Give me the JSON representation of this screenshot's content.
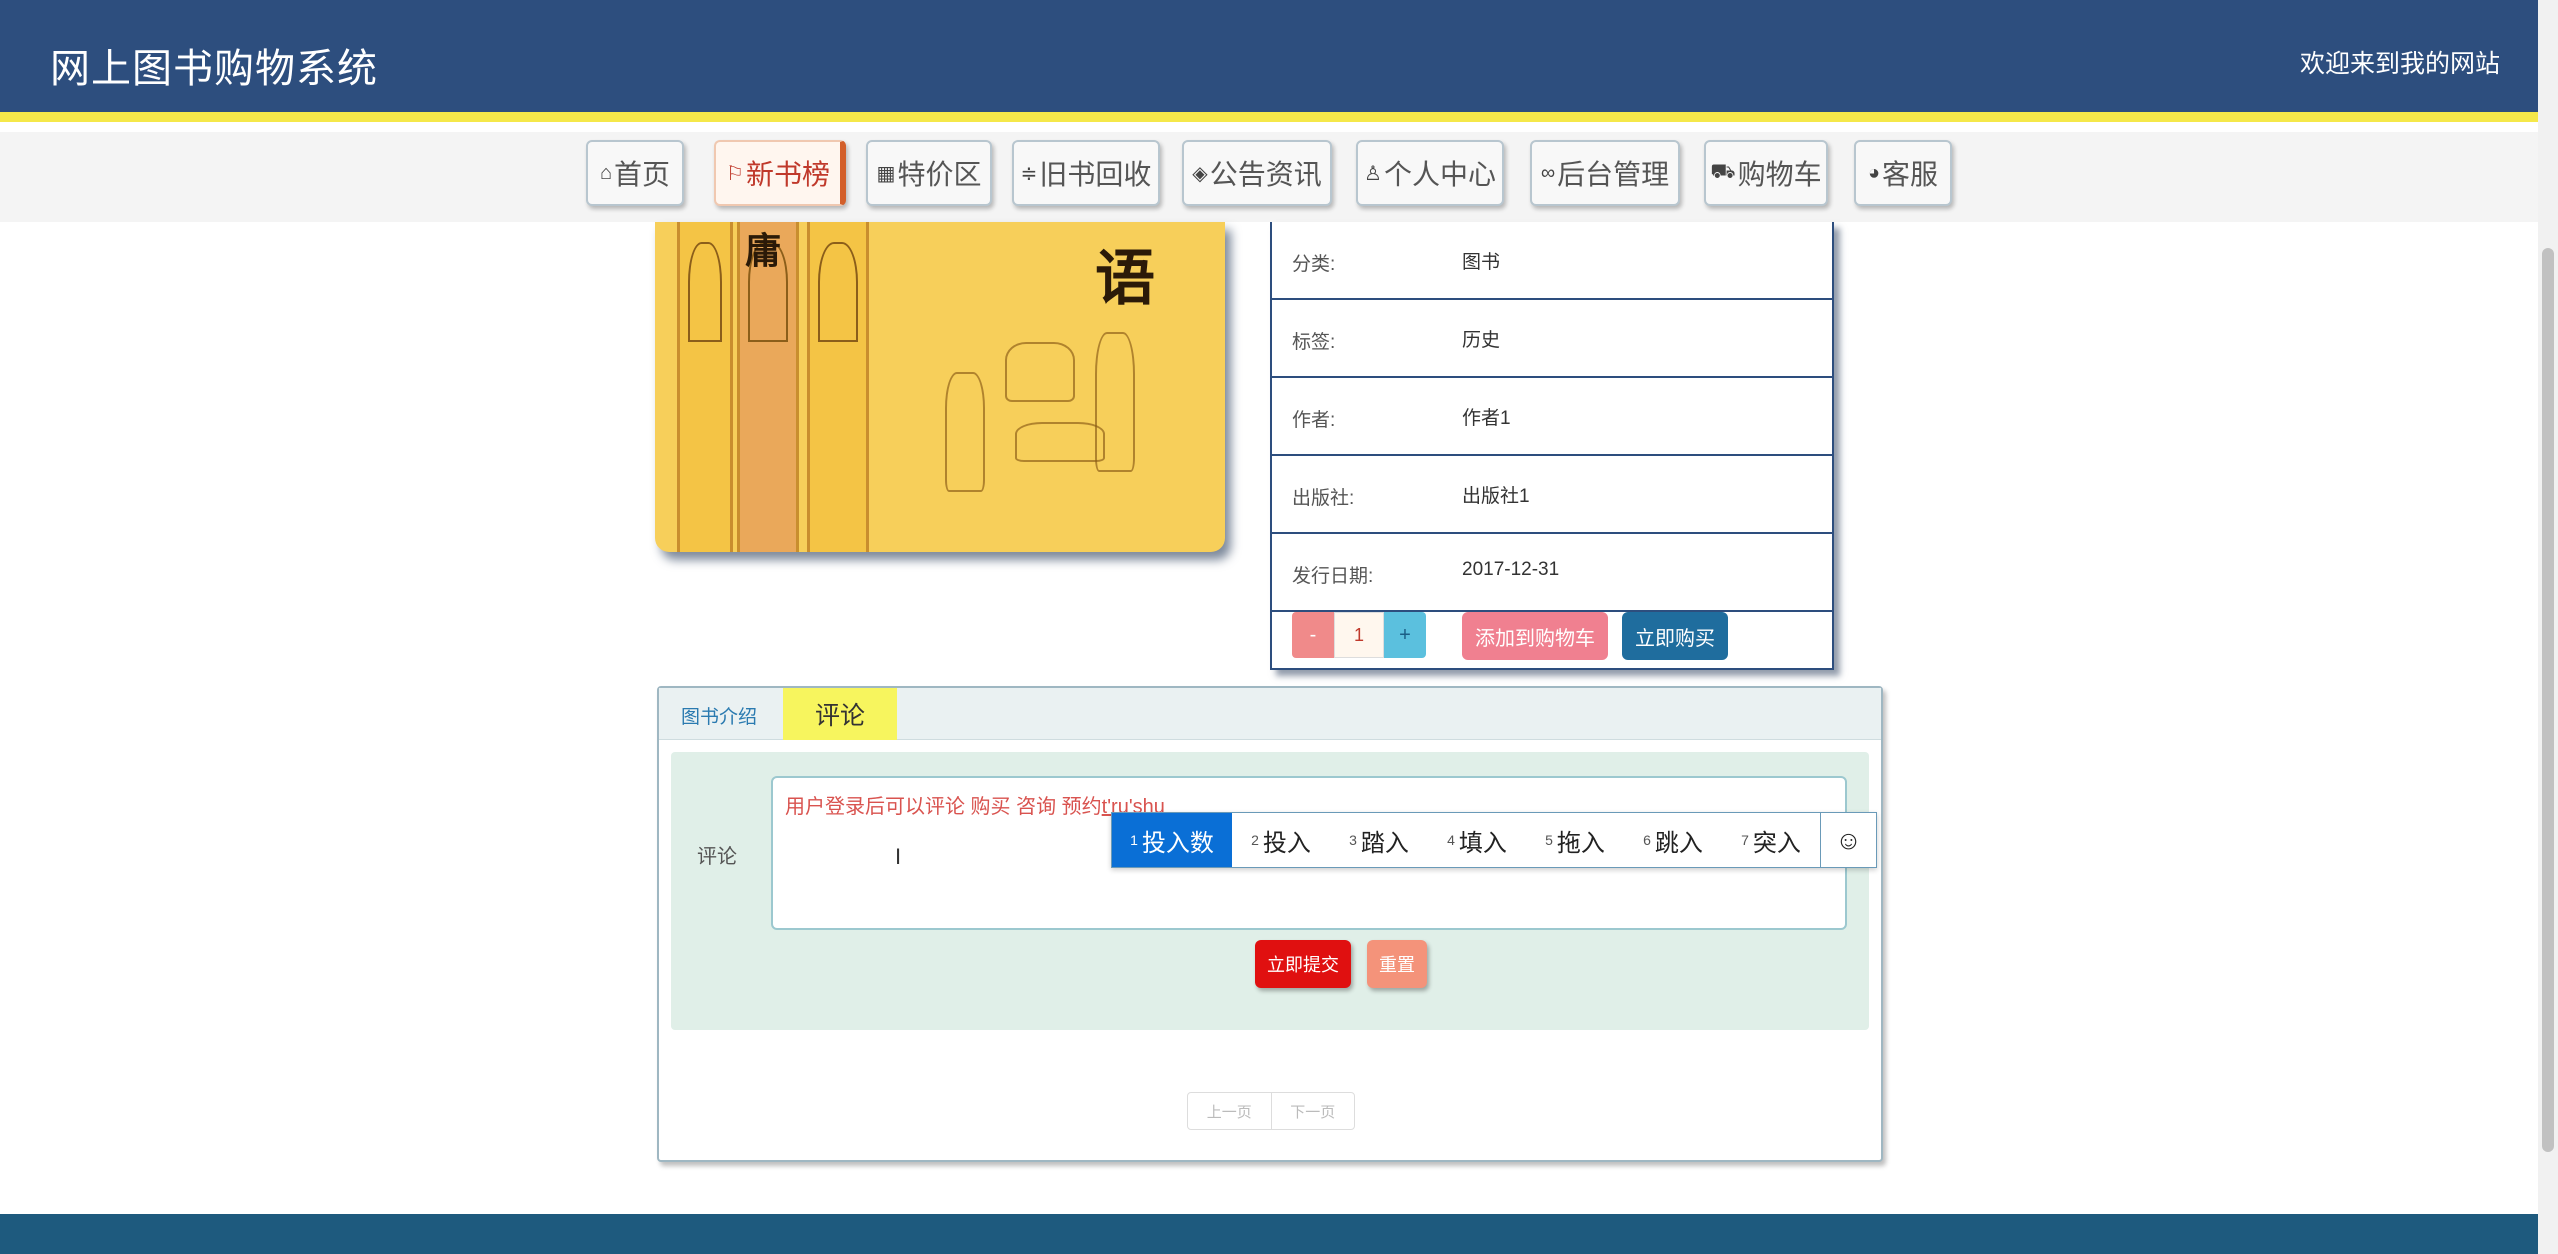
{
  "header": {
    "title": "网上图书购物系统",
    "welcome": "欢迎来到我的网站"
  },
  "nav": [
    {
      "label": "首页",
      "icon": "home-icon"
    },
    {
      "label": "新书榜",
      "icon": "flag-icon"
    },
    {
      "label": "特价区",
      "icon": "apps-icon"
    },
    {
      "label": "旧书回收",
      "icon": "sliders-icon"
    },
    {
      "label": "公告资讯",
      "icon": "layers-icon"
    },
    {
      "label": "个人中心",
      "icon": "user-icon"
    },
    {
      "label": "后台管理",
      "icon": "link-icon"
    },
    {
      "label": "购物车",
      "icon": "cart-icon"
    },
    {
      "label": "客服",
      "icon": "chat-icon"
    }
  ],
  "book": {
    "cover_title_char": "语",
    "spine_char": "庸",
    "info": [
      {
        "key": "分类:",
        "value": "图书"
      },
      {
        "key": "标签:",
        "value": "历史"
      },
      {
        "key": "作者:",
        "value": "作者1"
      },
      {
        "key": "出版社:",
        "value": "出版社1"
      },
      {
        "key": "发行日期:",
        "value": "2017-12-31"
      }
    ],
    "quantity": "1",
    "minus_label": "-",
    "plus_label": "+",
    "add_to_cart": "添加到购物车",
    "buy_now": "立即购买"
  },
  "tabs": {
    "intro": "图书介绍",
    "comment": "评论"
  },
  "comment": {
    "label": "评论",
    "text_prefix": "用户登录后可以评论  购买  咨询  预约",
    "text_typed": "t'ru'shu",
    "submit": "立即提交",
    "reset": "重置"
  },
  "pager": {
    "prev": "上一页",
    "next": "下一页"
  },
  "ime": {
    "candidates": [
      {
        "n": "1",
        "text": "投入数"
      },
      {
        "n": "2",
        "text": "投入"
      },
      {
        "n": "3",
        "text": "踏入"
      },
      {
        "n": "4",
        "text": "填入"
      },
      {
        "n": "5",
        "text": "拖入"
      },
      {
        "n": "6",
        "text": "跳入"
      },
      {
        "n": "7",
        "text": "突入"
      }
    ],
    "emoji": "☺"
  }
}
